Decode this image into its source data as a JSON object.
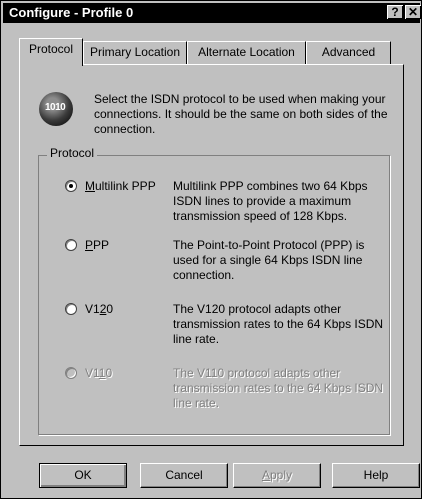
{
  "window": {
    "title": "Configure - Profile 0",
    "help_glyph": "?",
    "close_glyph": "✕"
  },
  "tabs": [
    {
      "label": "Protocol",
      "active": true
    },
    {
      "label": "Primary Location",
      "active": false
    },
    {
      "label": "Alternate Location",
      "active": false
    },
    {
      "label": "Advanced",
      "active": false
    }
  ],
  "intro": {
    "icon": "globe-1010-icon",
    "icon_text": "1010",
    "text": "Select the ISDN protocol to be used when making your connections. It should be the same on both sides of the connection."
  },
  "protocol_group": {
    "label": "Protocol",
    "options": [
      {
        "label": "Multilink PPP",
        "mnemonic": "M",
        "rest": "ultilink PPP",
        "checked": true,
        "enabled": true,
        "description": "Multilink PPP combines two 64 Kbps ISDN lines to provide a maximum transmission speed of 128 Kbps."
      },
      {
        "label": "PPP",
        "mnemonic": "P",
        "rest": "PP",
        "checked": false,
        "enabled": true,
        "description": "The Point-to-Point Protocol (PPP) is used for a single 64 Kbps ISDN line connection."
      },
      {
        "label": "V120",
        "prefix": "V1",
        "mnemonic": "2",
        "rest": "0",
        "checked": false,
        "enabled": true,
        "description": "The V120 protocol adapts other transmission rates to the 64 Kbps ISDN line rate."
      },
      {
        "label": "V110",
        "prefix": "V1",
        "mnemonic": "1",
        "rest": "0",
        "checked": false,
        "enabled": false,
        "description": "The V110 protocol adapts other transmission rates to the 64 Kbps ISDN line rate."
      }
    ]
  },
  "buttons": {
    "ok": "OK",
    "cancel": "Cancel",
    "apply": "Apply",
    "apply_mnemonic": "A",
    "apply_rest": "pply",
    "help": "Help"
  }
}
